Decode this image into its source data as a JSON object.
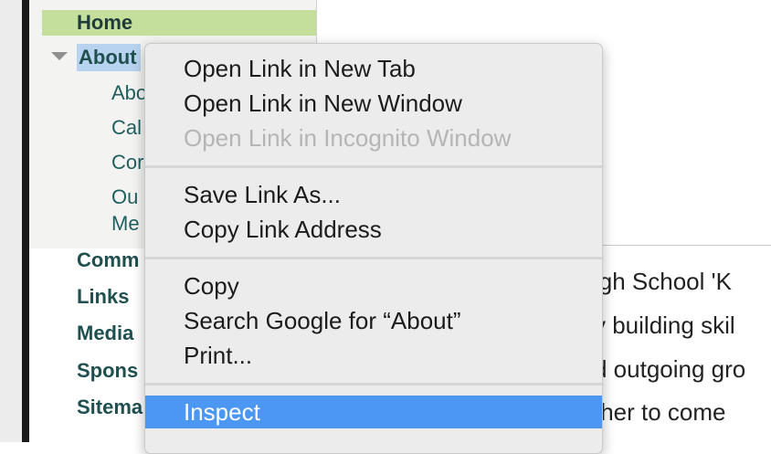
{
  "sidebar": {
    "home": "Home",
    "about": "About",
    "about_subitems": [
      "Abo",
      "Cal",
      "Cor",
      "Ou",
      "Me"
    ],
    "main_items": [
      "Comm",
      "Links",
      "Media",
      "Spons",
      "Sitema"
    ]
  },
  "content": {
    "lines": [
      "igh School 'K",
      "y building skil",
      "d outgoing gro",
      "ther to come"
    ]
  },
  "context_menu": {
    "group1": {
      "open_new_tab": "Open Link in New Tab",
      "open_new_window": "Open Link in New Window",
      "open_incognito": "Open Link in Incognito Window"
    },
    "group2": {
      "save_link_as": "Save Link As...",
      "copy_link_address": "Copy Link Address"
    },
    "group3": {
      "copy": "Copy",
      "search_google": "Search Google for “About”",
      "print": "Print..."
    },
    "group4": {
      "inspect": "Inspect"
    }
  },
  "colors": {
    "home_highlight": "#c4df9b",
    "about_highlight": "#b8d3ef",
    "menu_selected": "#4b97f1",
    "nav_text": "#1f4f4f"
  }
}
